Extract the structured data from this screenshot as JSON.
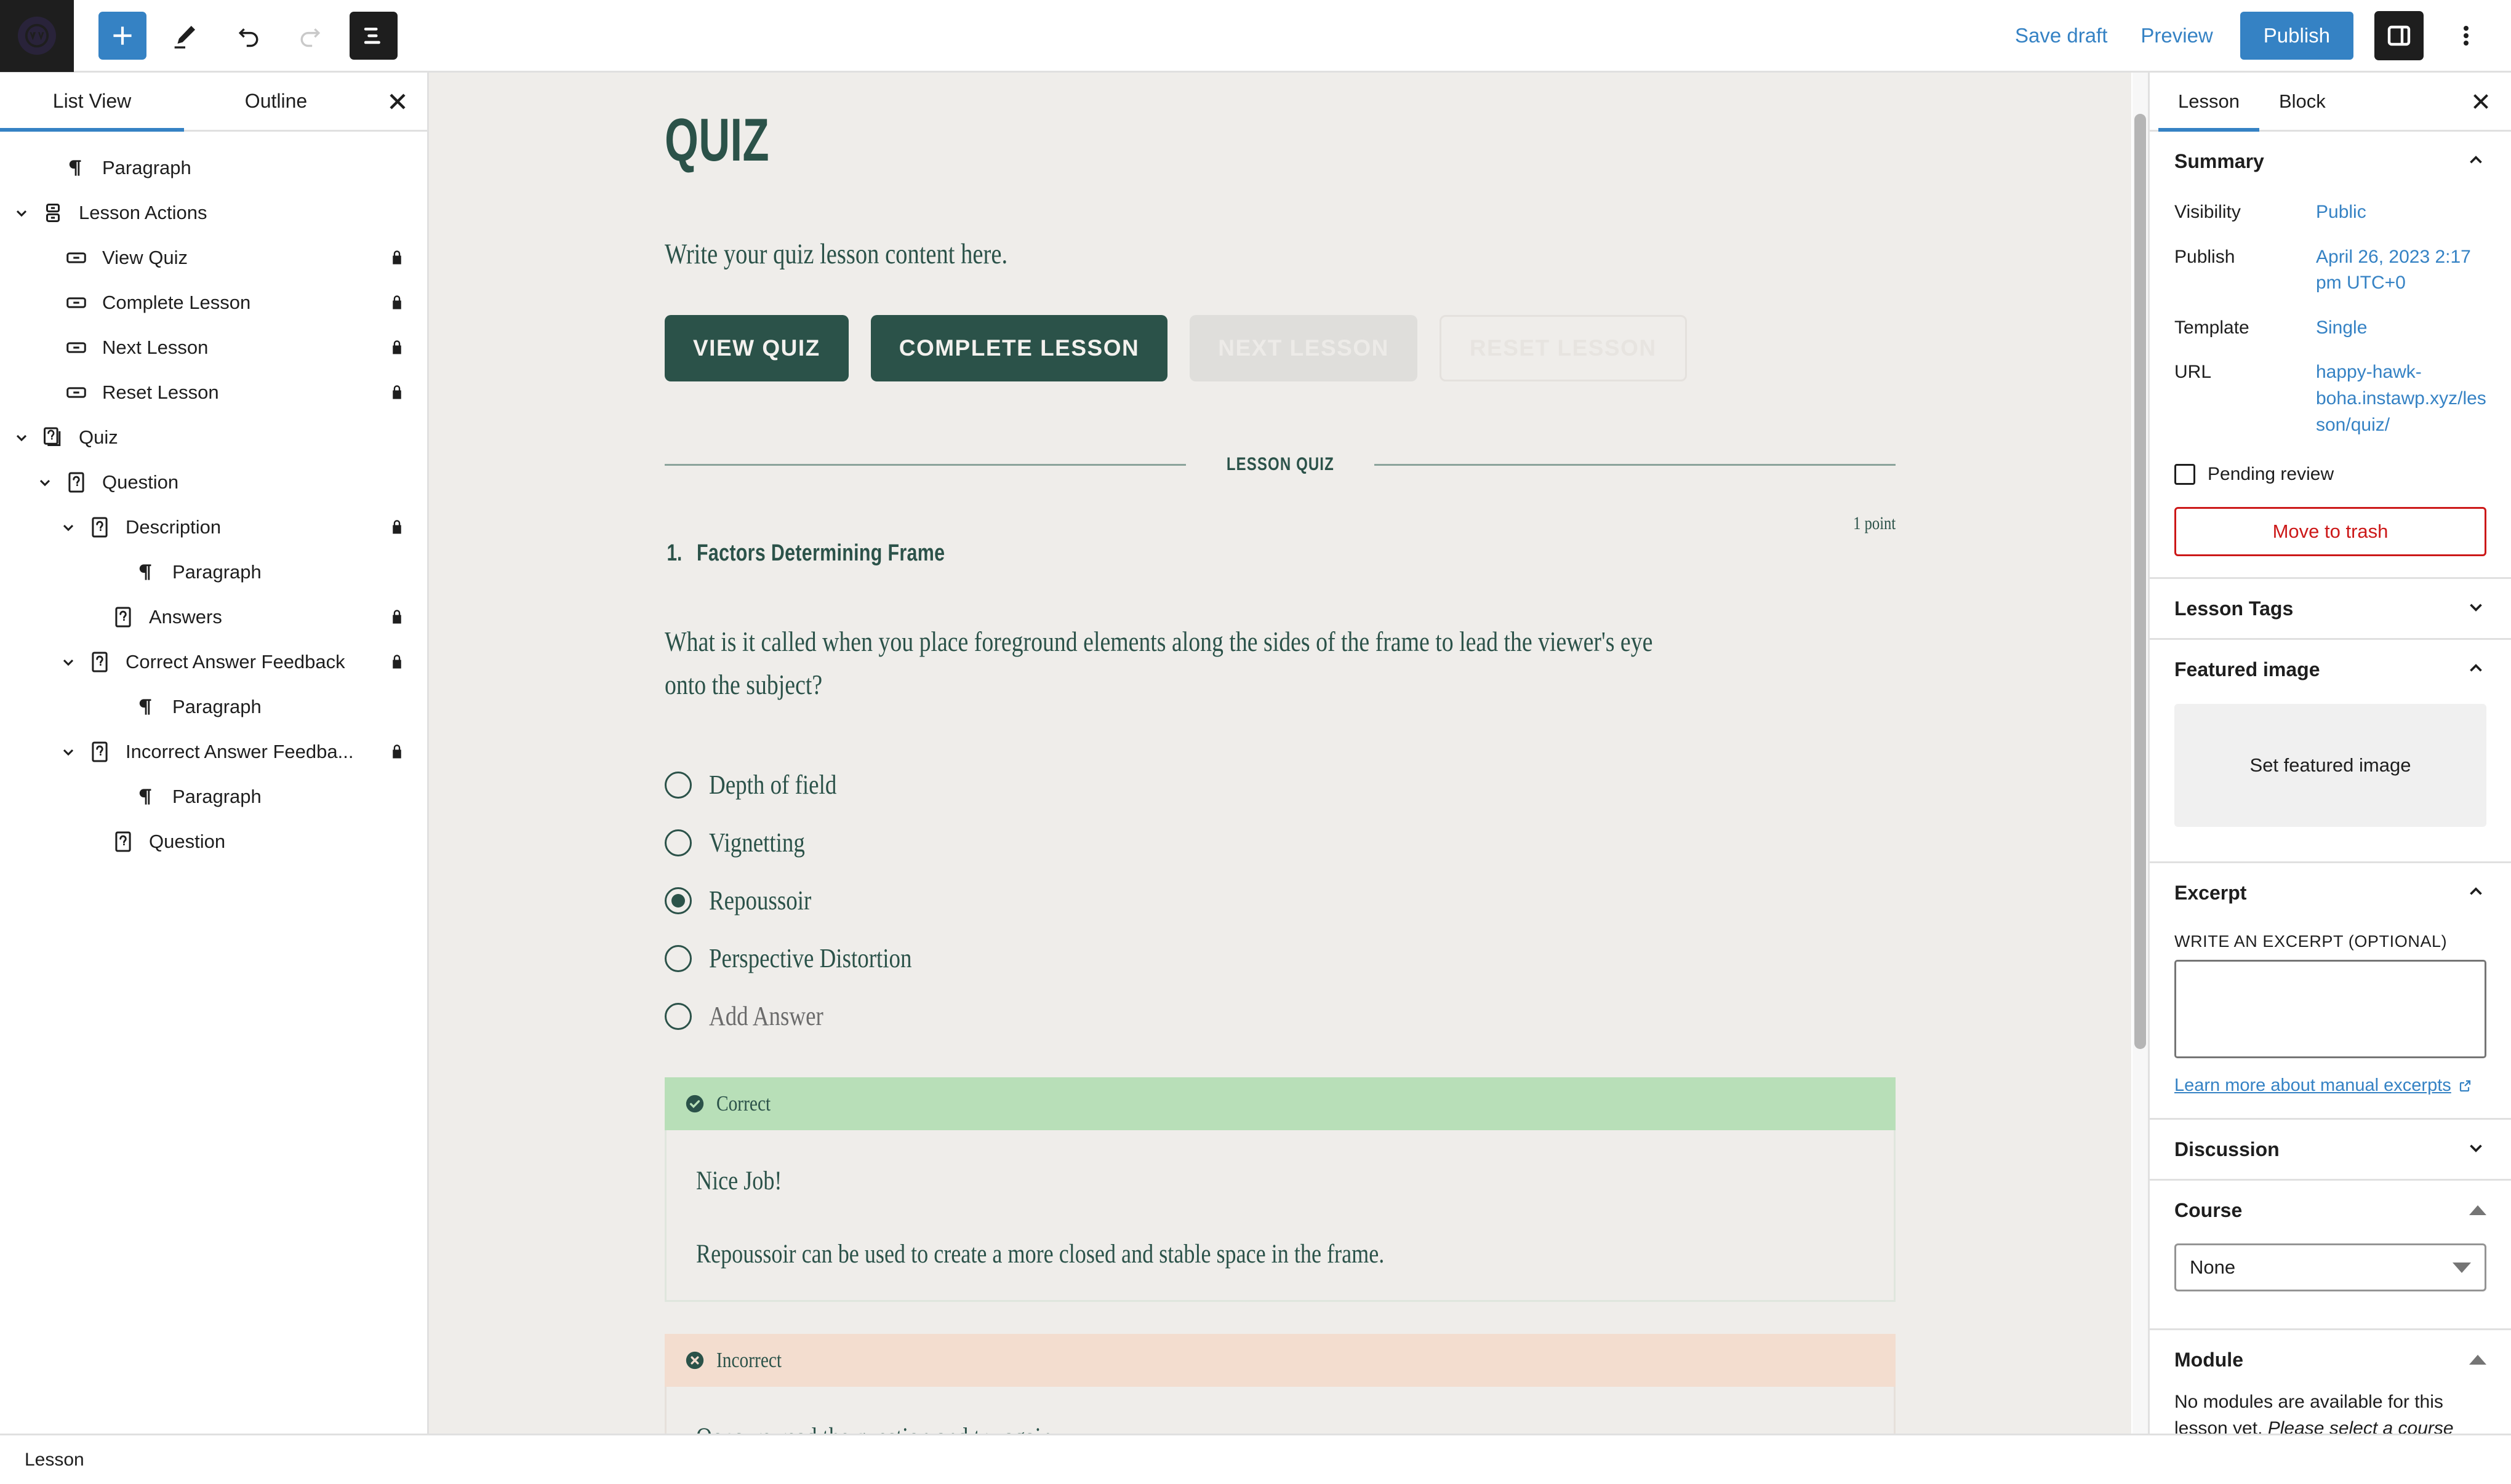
{
  "topbar": {
    "add_icon": "plus-icon",
    "tools_icon": "pencil-icon",
    "undo_icon": "undo-icon",
    "redo_icon": "redo-icon",
    "listview_icon": "list-view-icon",
    "save_draft": "Save draft",
    "preview": "Preview",
    "publish": "Publish",
    "settings_icon": "settings-sidebar-icon",
    "options_icon": "kebab-menu-icon",
    "accent_blue": "#3582c4"
  },
  "list_view": {
    "tabs": [
      {
        "label": "List View",
        "active": true
      },
      {
        "label": "Outline",
        "active": false
      }
    ],
    "close_icon": "close-icon",
    "items": [
      {
        "label": "Paragraph",
        "icon": "paragraph-icon",
        "indent": 1,
        "chevron": "none",
        "locked": false
      },
      {
        "label": "Lesson Actions",
        "icon": "lesson-actions-icon",
        "indent": 0,
        "chevron": "down",
        "locked": false
      },
      {
        "label": "View Quiz",
        "icon": "button-icon",
        "indent": 1,
        "chevron": "none",
        "locked": true
      },
      {
        "label": "Complete Lesson",
        "icon": "button-icon",
        "indent": 1,
        "chevron": "none",
        "locked": true
      },
      {
        "label": "Next Lesson",
        "icon": "button-icon",
        "indent": 1,
        "chevron": "none",
        "locked": true
      },
      {
        "label": "Reset Lesson",
        "icon": "button-icon",
        "indent": 1,
        "chevron": "none",
        "locked": true
      },
      {
        "label": "Quiz",
        "icon": "quiz-icon",
        "indent": 0,
        "chevron": "down",
        "locked": false
      },
      {
        "label": "Question",
        "icon": "question-icon",
        "indent": 1,
        "chevron": "down",
        "locked": false
      },
      {
        "label": "Description",
        "icon": "question-icon",
        "indent": 2,
        "chevron": "down",
        "locked": true
      },
      {
        "label": "Paragraph",
        "icon": "paragraph-icon",
        "indent": 4,
        "chevron": "none",
        "locked": false
      },
      {
        "label": "Answers",
        "icon": "question-icon",
        "indent": 3,
        "chevron": "none",
        "locked": true
      },
      {
        "label": "Correct Answer Feedback",
        "icon": "question-icon",
        "indent": 2,
        "chevron": "down",
        "locked": true
      },
      {
        "label": "Paragraph",
        "icon": "paragraph-icon",
        "indent": 4,
        "chevron": "none",
        "locked": false
      },
      {
        "label": "Incorrect Answer Feedba...",
        "icon": "question-icon",
        "indent": 2,
        "chevron": "down",
        "locked": true
      },
      {
        "label": "Paragraph",
        "icon": "paragraph-icon",
        "indent": 4,
        "chevron": "none",
        "locked": false
      },
      {
        "label": "Question",
        "icon": "question-icon",
        "indent": 3,
        "chevron": "none",
        "locked": false
      }
    ]
  },
  "content": {
    "title": "QUIZ",
    "intro": "Write your quiz lesson content here.",
    "buttons": [
      {
        "label": "VIEW QUIZ",
        "state": "primary"
      },
      {
        "label": "COMPLETE LESSON",
        "state": "primary"
      },
      {
        "label": "NEXT LESSON",
        "state": "disabled"
      },
      {
        "label": "RESET LESSON",
        "state": "ghost"
      }
    ],
    "divider_label": "LESSON QUIZ",
    "question": {
      "number": "1.",
      "title": "Factors Determining Frame",
      "points": "1 point",
      "text": "What is it called when you place foreground elements along the sides of the frame to lead the viewer's eye onto the subject?",
      "answers": [
        {
          "label": "Depth of field",
          "checked": false,
          "placeholder": false
        },
        {
          "label": "Vignetting",
          "checked": false,
          "placeholder": false
        },
        {
          "label": "Repoussoir",
          "checked": true,
          "placeholder": false
        },
        {
          "label": "Perspective Distortion",
          "checked": false,
          "placeholder": false
        },
        {
          "label": "Add Answer",
          "checked": false,
          "placeholder": true
        }
      ],
      "correct_feedback": {
        "header": "Correct",
        "icon": "check-circle-icon",
        "paragraphs": [
          "Nice Job!",
          "Repoussoir can be used to create a more closed and stable space in the frame."
        ]
      },
      "incorrect_feedback": {
        "header": "Incorrect",
        "icon": "x-circle-icon",
        "paragraphs": [
          "Oops, re-read the question and try again."
        ]
      }
    },
    "theme": {
      "background": "#efedea",
      "accent_green": "#2b5249",
      "correct_bg": "#b8dfb8",
      "incorrect_bg": "#f3ddcf"
    }
  },
  "sidebar": {
    "tabs": [
      {
        "label": "Lesson",
        "active": true
      },
      {
        "label": "Block",
        "active": false
      }
    ],
    "close_icon": "close-icon",
    "summary": {
      "title": "Summary",
      "expanded": true,
      "fields": [
        {
          "label": "Visibility",
          "value": "Public"
        },
        {
          "label": "Publish",
          "value": "April 26, 2023 2:17 pm UTC+0"
        },
        {
          "label": "Template",
          "value": "Single"
        },
        {
          "label": "URL",
          "value": "happy-hawk-boha.instawp.xyz/lesson/quiz/"
        }
      ],
      "pending_review": "Pending review",
      "pending_checked": false,
      "trash_button": "Move to trash"
    },
    "lesson_tags": {
      "title": "Lesson Tags",
      "expanded": false
    },
    "featured_image": {
      "title": "Featured image",
      "expanded": true,
      "placeholder": "Set featured image"
    },
    "excerpt": {
      "title": "Excerpt",
      "expanded": true,
      "field_label": "WRITE AN EXCERPT (OPTIONAL)",
      "value": "",
      "learn_more": "Learn more about manual excerpts"
    },
    "discussion": {
      "title": "Discussion",
      "expanded": false
    },
    "course": {
      "title": "Course",
      "expanded": true,
      "selected": "None"
    },
    "module": {
      "title": "Module",
      "expanded": true,
      "note_plain": "No modules are available for this lesson yet. ",
      "note_italic": "Please select a course first."
    }
  },
  "status_bar": {
    "label": "Lesson"
  }
}
